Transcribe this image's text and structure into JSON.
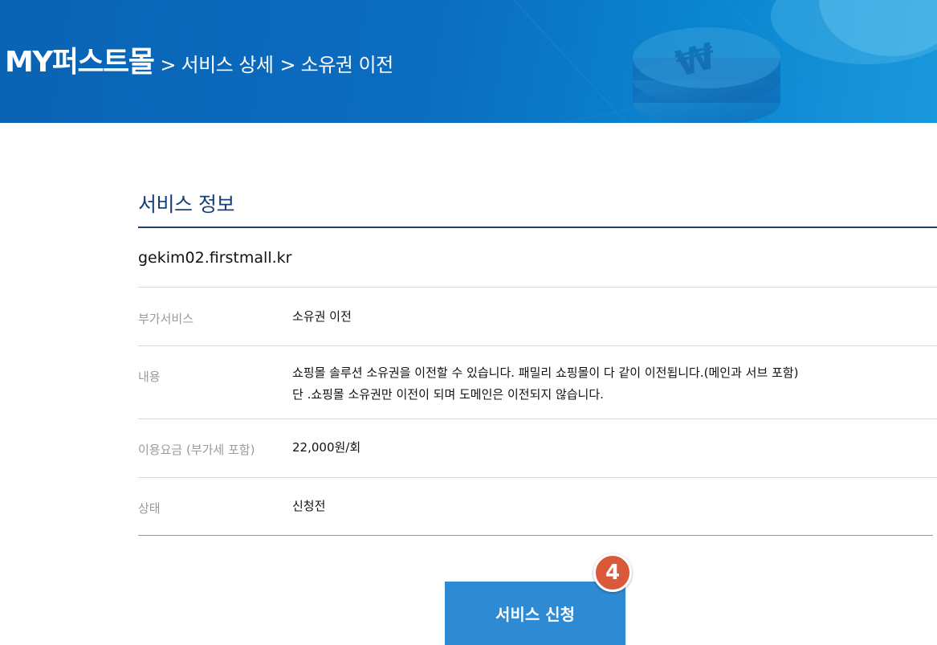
{
  "breadcrumb": {
    "root": "MY퍼스트몰",
    "separator": ">",
    "items": [
      "서비스 상세",
      "소유권 이전"
    ]
  },
  "section": {
    "title": "서비스 정보",
    "domain": "gekim02.firstmall.kr"
  },
  "rows": [
    {
      "label": "부가서비스",
      "lines": [
        "소유권 이전"
      ]
    },
    {
      "label": "내용",
      "lines": [
        "쇼핑몰 솔루션 소유권을 이전할 수 있습니다. 패밀리 쇼핑몰이 다 같이 이전됩니다.(메인과 서브 포함)",
        "단 .쇼핑몰 소유권만 이전이 되며 도메인은 이전되지 않습니다."
      ]
    },
    {
      "label": "이용요금 (부가세 포함)",
      "lines": [
        "22,000원/회"
      ]
    },
    {
      "label": "상태",
      "lines": [
        "신청전"
      ]
    }
  ],
  "action": {
    "label": "서비스 신청",
    "badge": "4"
  },
  "colors": {
    "banner": "#0b6cc0",
    "title": "#183f7a",
    "button": "#2e8ad3",
    "badge": "#d9593a"
  },
  "icons": {
    "banner_decoration": "coin-stack-icon"
  }
}
